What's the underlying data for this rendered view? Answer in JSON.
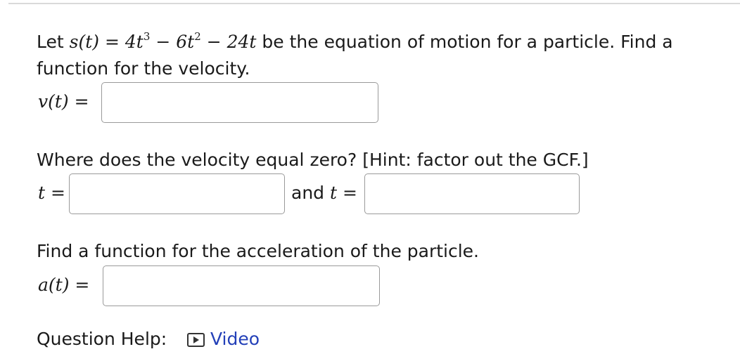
{
  "question": {
    "line1_prefix": "Let",
    "s_label": "s(t)",
    "equals": "=",
    "term1_coef": "4t",
    "term1_exp": "3",
    "minus1": "−",
    "term2_coef": "6t",
    "term2_exp": "2",
    "minus2": "−",
    "term3": "24t",
    "line1_suffix": "be the equation of motion for a particle. Find a",
    "line2": "function for the velocity."
  },
  "velocity": {
    "label": "v(t)",
    "equals": "=",
    "value": ""
  },
  "zeros": {
    "prompt": "Where does the velocity equal zero? [Hint: factor out the GCF.]",
    "label1": "t",
    "equals1": "=",
    "value1": "",
    "and_text": "and",
    "label2": "t",
    "equals2": "=",
    "value2": ""
  },
  "acceleration": {
    "prompt": "Find a function for the acceleration of the particle.",
    "label": "a(t)",
    "equals": "=",
    "value": ""
  },
  "help": {
    "label": "Question Help:",
    "video_icon": "play-video-icon",
    "video_label": "Video"
  },
  "colors": {
    "link": "#2340b8",
    "border": "#9a9a9a",
    "divider": "#d9d9d9"
  }
}
